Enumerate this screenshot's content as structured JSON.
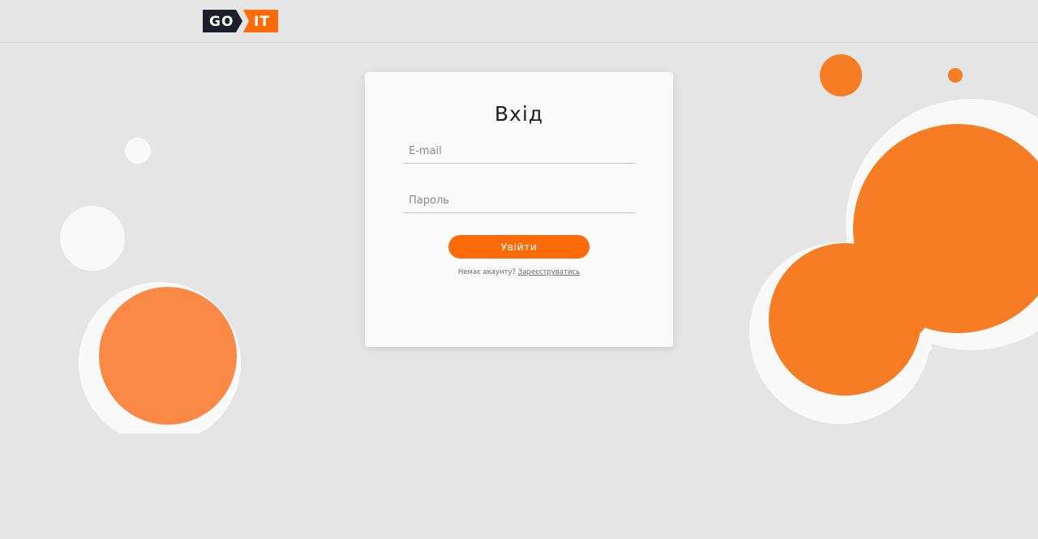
{
  "header": {
    "logo": {
      "left_text": "GO",
      "right_text": "IT",
      "dark_color": "#1e1e2a",
      "accent_color": "#ff6b08"
    }
  },
  "login": {
    "title": "Вхід",
    "email_placeholder": "E-mail",
    "password_placeholder": "Пароль",
    "submit_label": "Увійти",
    "no_account_text": "Немає акаунту?",
    "register_link": "Зареєструватись"
  },
  "colors": {
    "background": "#e5e5e5",
    "card": "#fafafa",
    "accent": "#ff6b08",
    "bubble_orange": "#f77d24",
    "bubble_white": "#f9f9f9"
  }
}
